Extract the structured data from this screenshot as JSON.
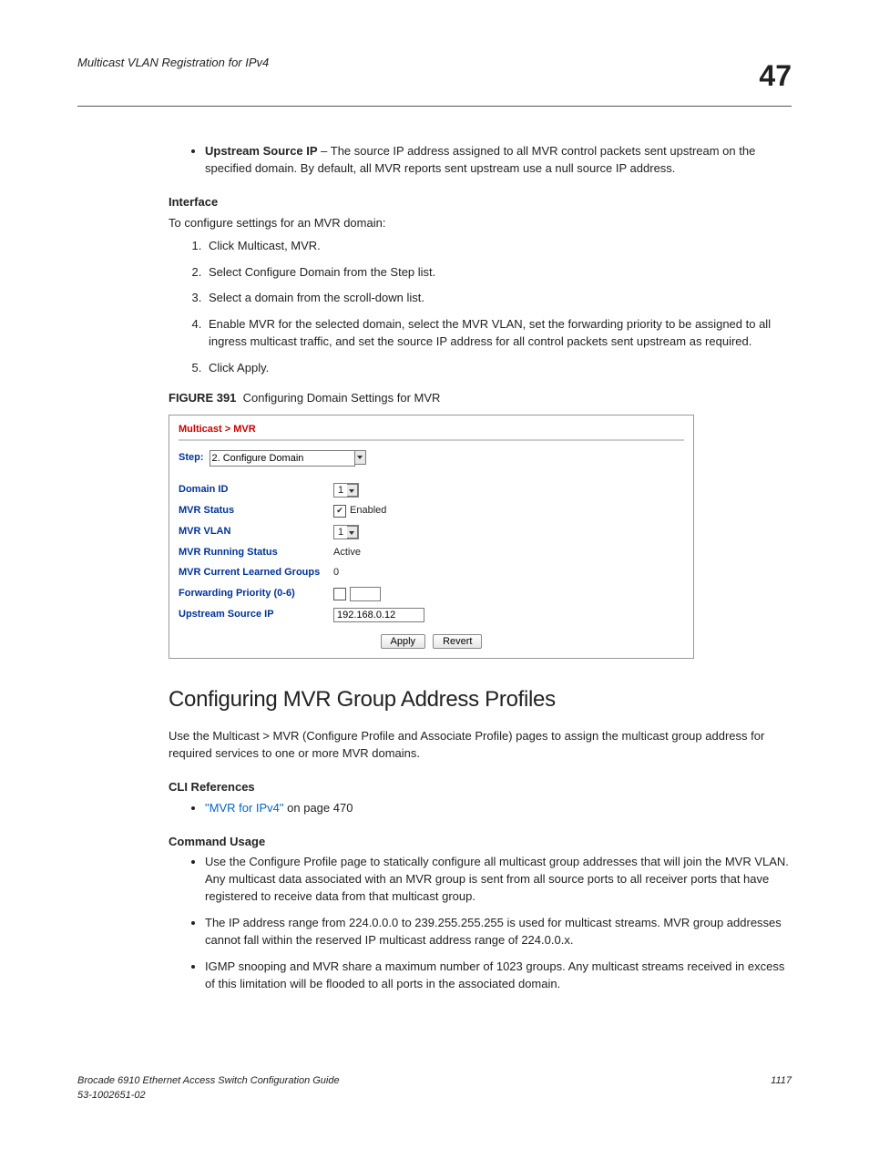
{
  "header": {
    "title": "Multicast VLAN Registration for IPv4",
    "chapter": "47"
  },
  "upstream_bullet": {
    "label": "Upstream Source IP",
    "text": " – The source IP address assigned to all MVR control packets sent upstream on the specified domain. By default, all MVR reports sent upstream use a null source IP address."
  },
  "interface": {
    "heading": "Interface",
    "intro": "To configure settings for an MVR domain:",
    "steps": [
      "Click Multicast, MVR.",
      "Select Configure Domain from the Step list.",
      "Select a domain from the scroll-down list.",
      "Enable MVR for the selected domain, select the MVR VLAN, set the forwarding priority to be assigned to all ingress multicast traffic, and set the source IP address for all control packets sent upstream as required.",
      "Click Apply."
    ]
  },
  "figure": {
    "label": "FIGURE 391",
    "caption": "Configuring Domain Settings for MVR"
  },
  "panel": {
    "breadcrumb": "Multicast > MVR",
    "step_label": "Step:",
    "step_value": "2. Configure Domain",
    "rows": {
      "domain_id": {
        "label": "Domain ID",
        "value": "1"
      },
      "mvr_status": {
        "label": "MVR Status",
        "checked": true,
        "text": "Enabled"
      },
      "mvr_vlan": {
        "label": "MVR VLAN",
        "value": "1"
      },
      "running": {
        "label": "MVR Running Status",
        "value": "Active"
      },
      "learned": {
        "label": "MVR Current Learned Groups",
        "value": "0"
      },
      "priority": {
        "label": "Forwarding Priority (0-6)",
        "checked": false,
        "value": ""
      },
      "upstream": {
        "label": "Upstream Source IP",
        "value": "192.168.0.12"
      }
    },
    "apply": "Apply",
    "revert": "Revert"
  },
  "section2": {
    "title": "Configuring MVR Group Address Profiles",
    "intro": "Use the Multicast > MVR (Configure Profile and Associate Profile) pages to assign the multicast group address for required services to one or more MVR domains.",
    "cli_heading": "CLI References",
    "cli_link": "\"MVR for IPv4\"",
    "cli_tail": " on page 470",
    "cu_heading": "Command Usage",
    "bullets": [
      "Use the Configure Profile page to statically configure all multicast group addresses that will join the MVR VLAN. Any multicast data associated with an MVR group is sent from all source ports to all receiver ports that have registered to receive data from that multicast group.",
      "The IP address range from 224.0.0.0 to 239.255.255.255 is used for multicast streams. MVR group addresses cannot fall within the reserved IP multicast address range of 224.0.0.x.",
      "IGMP snooping and MVR share a maximum number of 1023 groups. Any multicast streams received in excess of this limitation will be flooded to all ports in the associated domain."
    ]
  },
  "footer": {
    "left1": "Brocade 6910 Ethernet Access Switch Configuration Guide",
    "left2": "53-1002651-02",
    "page": "1117"
  }
}
